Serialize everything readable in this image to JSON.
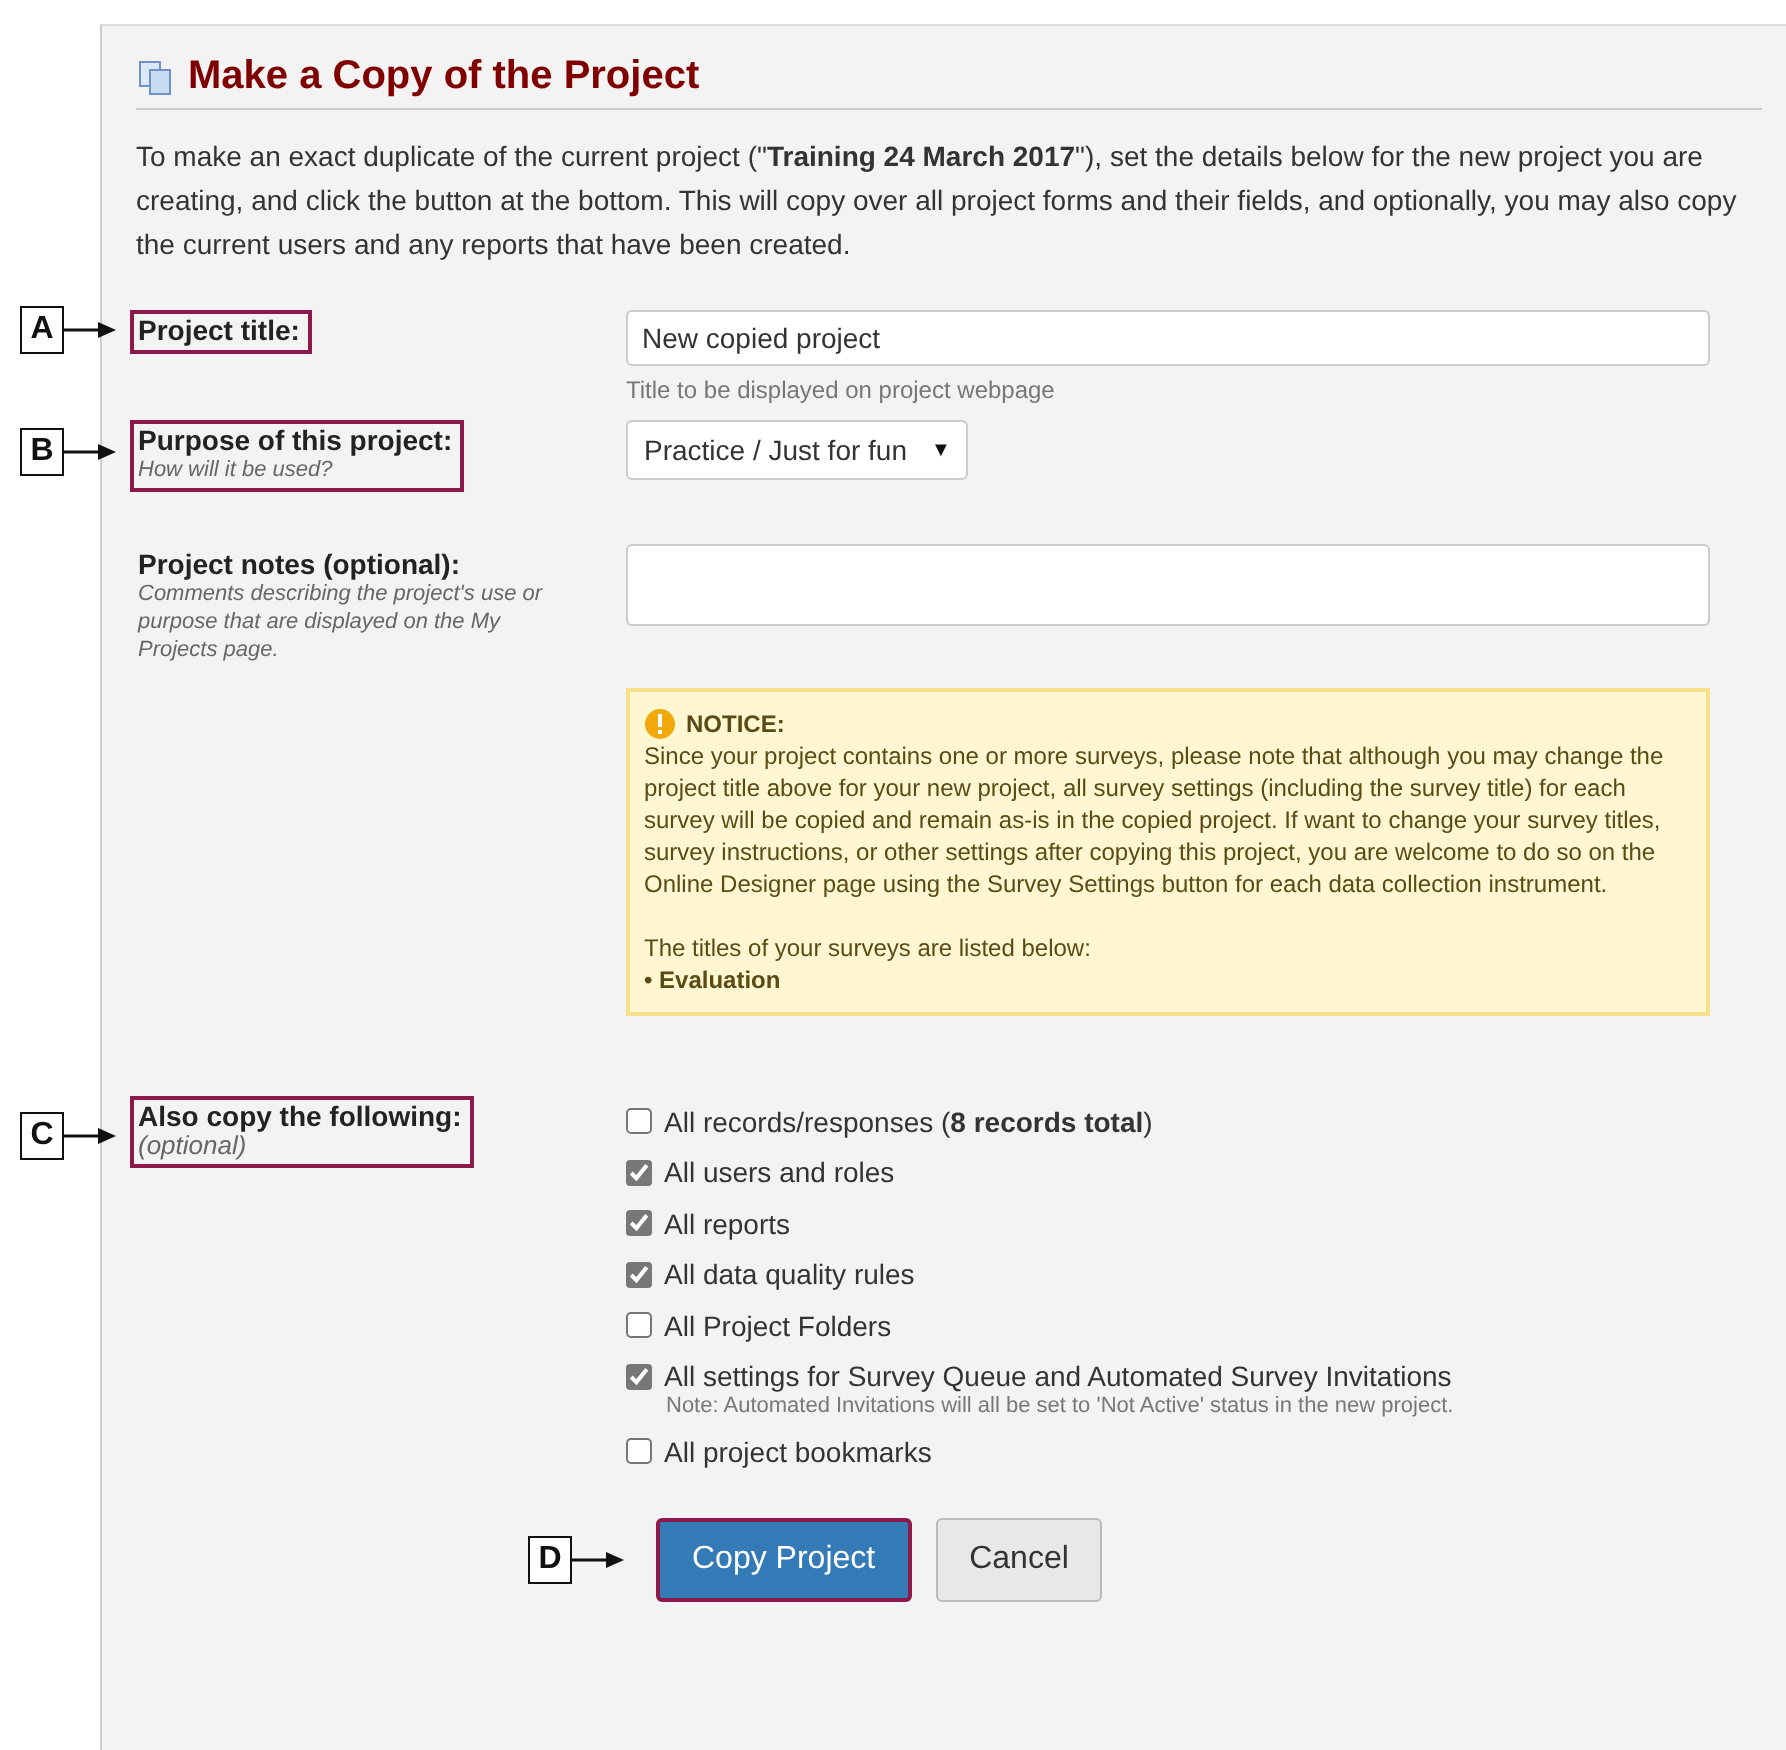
{
  "heading": "Make a Copy of the Project",
  "intro": "To make an exact duplicate of the current project (\"**Training 24 March 2017**\"), set the details below for the new project you are creating, and click the button at the bottom. This will copy over all project forms and their fields, and optionally, you may also copy the current users and any reports that have been created.",
  "fields": [
    {
      "kind": "text",
      "label": "Project title:",
      "callout": "A",
      "value": "New copied project",
      "hint": "Title to be displayed on project webpage"
    },
    {
      "kind": "select",
      "label": "Purpose of this project:",
      "sublabel": "How will it be used?",
      "callout": "B",
      "value": "Practice / Just for fun",
      "caret": "▼"
    },
    {
      "kind": "textarea",
      "label": "Project notes (optional):",
      "sublabel": "Comments describing the project's use or purpose that are displayed on the My Projects page."
    }
  ],
  "notice": {
    "title": "NOTICE:",
    "body": "Since your project contains one or more surveys, please note that although you may change the project title above for your new project, all survey settings (including the survey title) for each survey will be copied and remain as-is in the copied project. If want to change your survey titles, survey instructions, or other settings after copying this project, you are welcome to do so on the Online Designer page using the Survey Settings button for each data collection instrument.",
    "list_intro": "The titles of your surveys are listed below:",
    "items": [
      "• Evaluation"
    ]
  },
  "copy_options": {
    "label": "Also copy the following:",
    "sublabel": "(optional)",
    "callout": "C",
    "items": [
      {
        "label": "All records/responses (**8 records total**)",
        "checked": false
      },
      {
        "label": "All users and roles",
        "checked": true
      },
      {
        "label": "All reports",
        "checked": true
      },
      {
        "label": "All data quality rules",
        "checked": true
      },
      {
        "label": "All Project Folders",
        "checked": false
      },
      {
        "label": "All settings for Survey Queue and Automated Survey Invitations",
        "checked": true,
        "note": "Note: Automated Invitations will all be set to 'Not Active' status in the new project."
      },
      {
        "label": "All project bookmarks",
        "checked": false
      }
    ]
  },
  "buttons": [
    {
      "label": "Copy Project",
      "kind": "primary",
      "callout": "D"
    },
    {
      "label": "Cancel",
      "kind": "secondary"
    }
  ]
}
